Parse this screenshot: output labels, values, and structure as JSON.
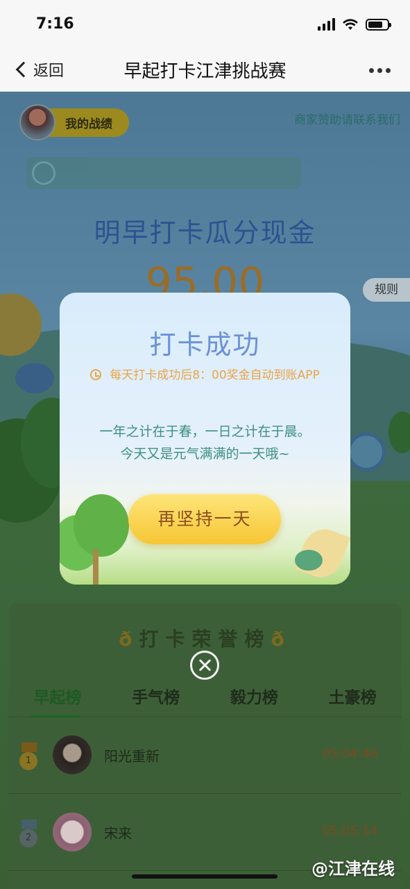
{
  "status_bar": {
    "time": "7:16"
  },
  "nav": {
    "back_label": "返回",
    "title": "早起打卡江津挑战赛"
  },
  "page": {
    "my_stats_label": "我的战绩",
    "sponsor_link": "商家赞助请联系我们",
    "headline": "明早打卡瓜分现金",
    "amount": "95.00",
    "rules_label": "规则"
  },
  "modal": {
    "title": "打卡成功",
    "subtitle": "每天打卡成功后8：00奖金自动到账APP",
    "quote_line1": "一年之计在于春，一日之计在于晨。",
    "quote_line2": "今天又是元气满满的一天哦~",
    "button_label": "再坚持一天"
  },
  "board": {
    "title": "打卡荣誉榜",
    "tabs": [
      {
        "label": "早起榜",
        "active": true
      },
      {
        "label": "手气榜",
        "active": false
      },
      {
        "label": "毅力榜",
        "active": false
      },
      {
        "label": "土豪榜",
        "active": false
      }
    ],
    "rows": [
      {
        "rank": "1",
        "name": "阳光重新",
        "time": "05:04:46"
      },
      {
        "rank": "2",
        "name": "宋来",
        "time": "05:05:14"
      }
    ]
  },
  "watermark": "@江津在线",
  "colors": {
    "modal_title": "#6b92d6",
    "modal_subtitle": "#e9a548",
    "quote": "#3d8f80",
    "button": "#f7c634"
  }
}
